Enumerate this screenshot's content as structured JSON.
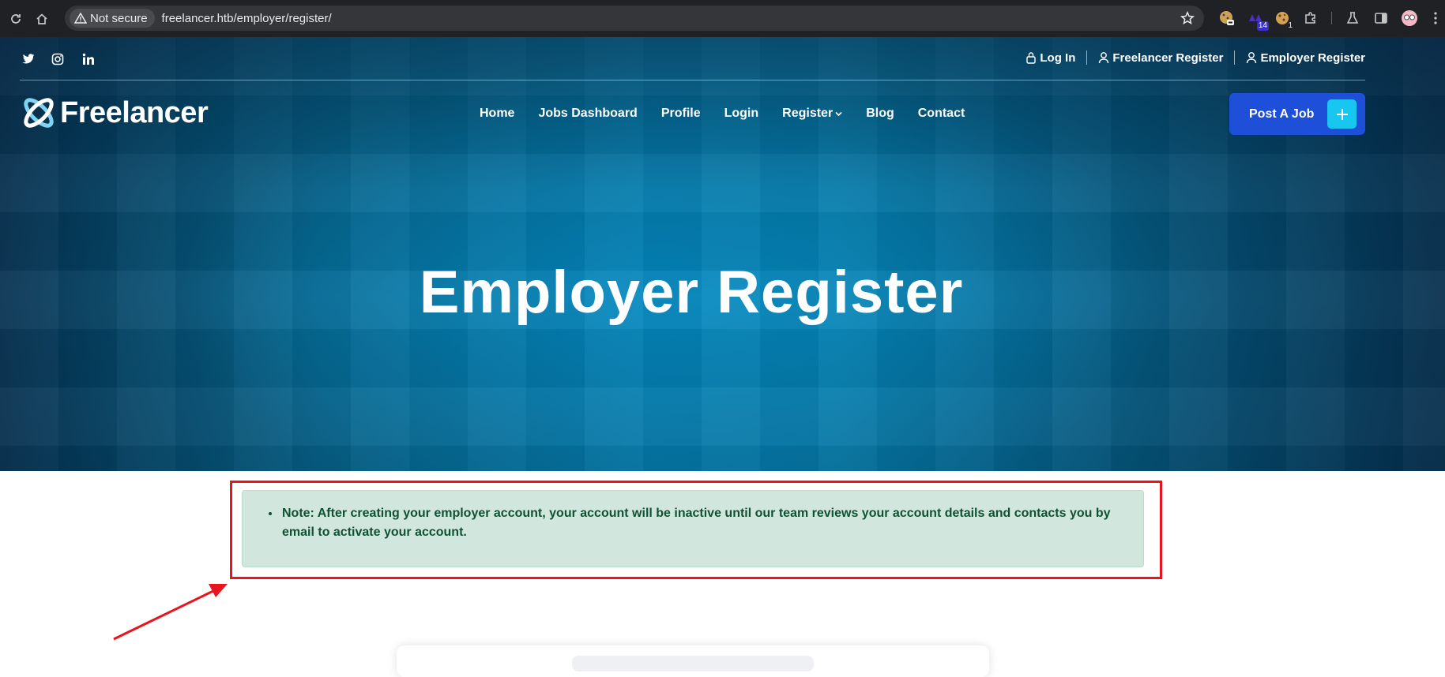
{
  "browser": {
    "security_label": "Not secure",
    "url": "freelancer.htb/employer/register/",
    "extensions": [
      {
        "icon": "cookie-editor-icon",
        "badge": ""
      },
      {
        "icon": "wappalyzer-icon",
        "badge": "14"
      },
      {
        "icon": "cookie-icon",
        "badge": "1"
      }
    ]
  },
  "topbar": {
    "socials": [
      "twitter-icon",
      "instagram-icon",
      "linkedin-icon"
    ],
    "links": [
      {
        "label": "Log In",
        "icon": "lock-icon"
      },
      {
        "label": "Freelancer Register",
        "icon": "user-icon"
      },
      {
        "label": "Employer Register",
        "icon": "user-icon"
      }
    ]
  },
  "brand": {
    "name": "Freelancer"
  },
  "nav": {
    "items": [
      "Home",
      "Jobs Dashboard",
      "Profile",
      "Login",
      "Register",
      "Blog",
      "Contact"
    ],
    "post_job_label": "Post A Job"
  },
  "hero": {
    "title": "Employer Register"
  },
  "note": {
    "text": "Note: After creating your employer account, your account will be inactive until our team reviews your account details and contacts you by email to activate your account."
  },
  "colors": {
    "accent": "#1d4fd8",
    "plus": "#18c7f0",
    "note_bg": "#d1e7dd",
    "note_text": "#0f5132",
    "highlight": "#e8141e"
  }
}
